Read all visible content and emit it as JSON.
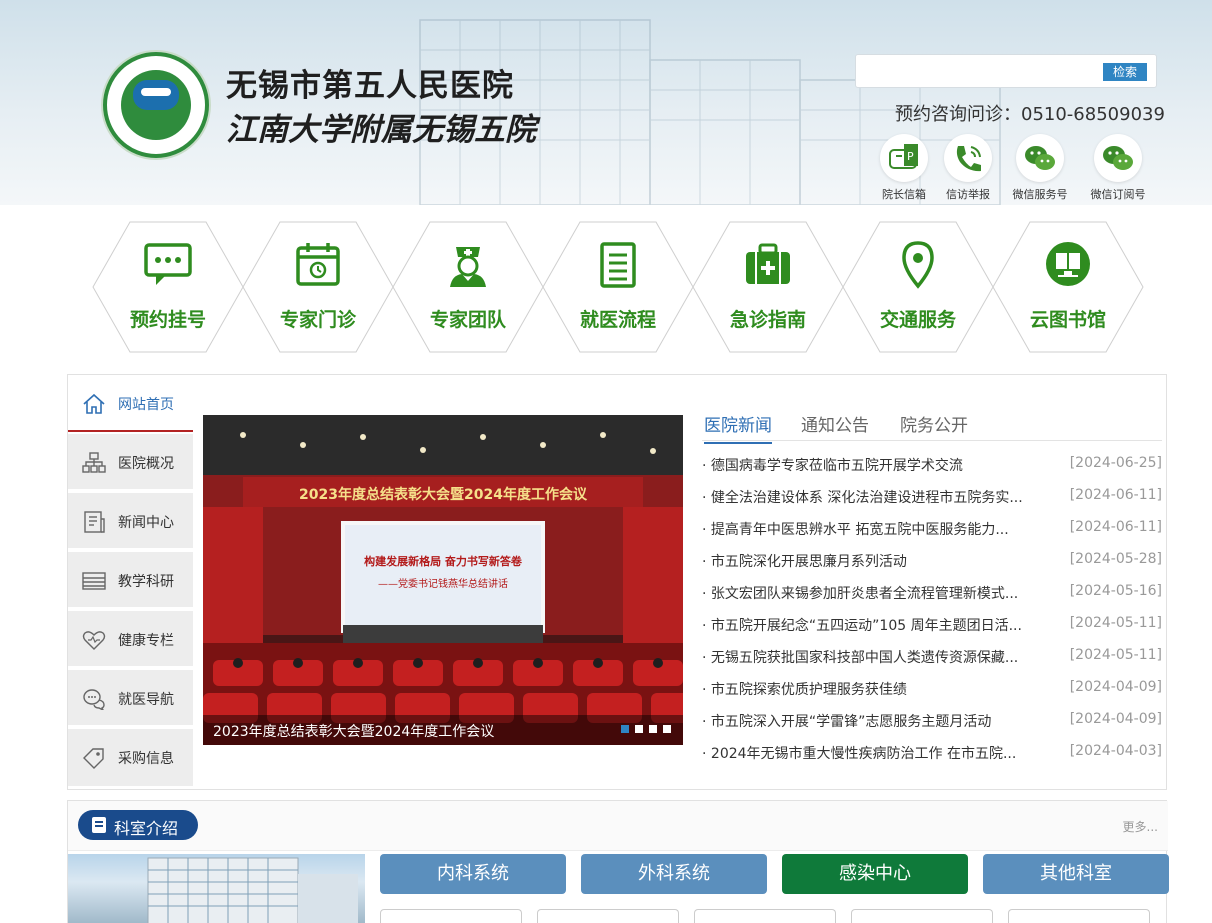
{
  "header": {
    "hospital_name": "无锡市第五人民医院",
    "hospital_subtitle": "江南大学附属无锡五院",
    "search_placeholder": "",
    "search_button": "检索",
    "hotline": "预约咨询问诊：0510-68509039",
    "quick_links": [
      {
        "label": "院长信箱",
        "icon": "mailbox-icon"
      },
      {
        "label": "信访举报",
        "icon": "phone-icon"
      },
      {
        "label": "微信服务号",
        "icon": "wechat-icon"
      },
      {
        "label": "微信订阅号",
        "icon": "wechat-icon"
      }
    ]
  },
  "hex_nav": [
    {
      "label": "预约挂号",
      "icon": "chat-icon"
    },
    {
      "label": "专家门诊",
      "icon": "calendar-icon"
    },
    {
      "label": "专家团队",
      "icon": "nurse-icon"
    },
    {
      "label": "就医流程",
      "icon": "document-icon"
    },
    {
      "label": "急诊指南",
      "icon": "medkit-icon"
    },
    {
      "label": "交通服务",
      "icon": "location-icon"
    },
    {
      "label": "云图书馆",
      "icon": "library-icon"
    }
  ],
  "side_nav": [
    {
      "label": "网站首页",
      "icon": "home-icon"
    },
    {
      "label": "医院概况",
      "icon": "org-chart-icon"
    },
    {
      "label": "新闻中心",
      "icon": "news-icon"
    },
    {
      "label": "教学科研",
      "icon": "layers-icon"
    },
    {
      "label": "健康专栏",
      "icon": "heart-icon"
    },
    {
      "label": "就医导航",
      "icon": "chat-bubbles-icon"
    },
    {
      "label": "采购信息",
      "icon": "tag-icon"
    }
  ],
  "slider": {
    "banner_text": "2023年度总结表彰大会暨2024年度工作会议",
    "screen_title": "构建发展新格局  奋力书写新答卷",
    "screen_sub": "——党委书记钱燕华总结讲话",
    "caption": "2023年度总结表彰大会暨2024年度工作会议"
  },
  "news": {
    "tabs": [
      "医院新闻",
      "通知公告",
      "院务公开"
    ],
    "items": [
      {
        "title": "德国病毒学专家莅临市五院开展学术交流",
        "date": "[2024-06-25]"
      },
      {
        "title": "健全法治建设体系 深化法治建设进程市五院务实...",
        "date": "[2024-06-11]"
      },
      {
        "title": "提高青年中医思辨水平 拓宽五院中医服务能力...",
        "date": "[2024-06-11]"
      },
      {
        "title": "市五院深化开展思廉月系列活动",
        "date": "[2024-05-28]"
      },
      {
        "title": "张文宏团队来锡参加肝炎患者全流程管理新模式...",
        "date": "[2024-05-16]"
      },
      {
        "title": "市五院开展纪念“五四运动”105 周年主题团日活...",
        "date": "[2024-05-11]"
      },
      {
        "title": "无锡五院获批国家科技部中国人类遗传资源保藏...",
        "date": "[2024-05-11]"
      },
      {
        "title": "市五院探索优质护理服务获佳绩",
        "date": "[2024-04-09]"
      },
      {
        "title": "市五院深入开展“学雷锋”志愿服务主题月活动",
        "date": "[2024-04-09]"
      },
      {
        "title": "2024年无锡市重大慢性疾病防治工作 在市五院...",
        "date": "[2024-04-03]"
      }
    ]
  },
  "dept": {
    "title": "科室介绍",
    "more": "更多...",
    "tabs": [
      "内科系统",
      "外科系统",
      "感染中心",
      "其他科室"
    ]
  },
  "colors": {
    "green": "#2f8c1f",
    "blue": "#2f6fb4",
    "navy": "#1a4b8c",
    "tab_blue": "#5b8fbd",
    "tab_green": "#0f7a3a"
  }
}
